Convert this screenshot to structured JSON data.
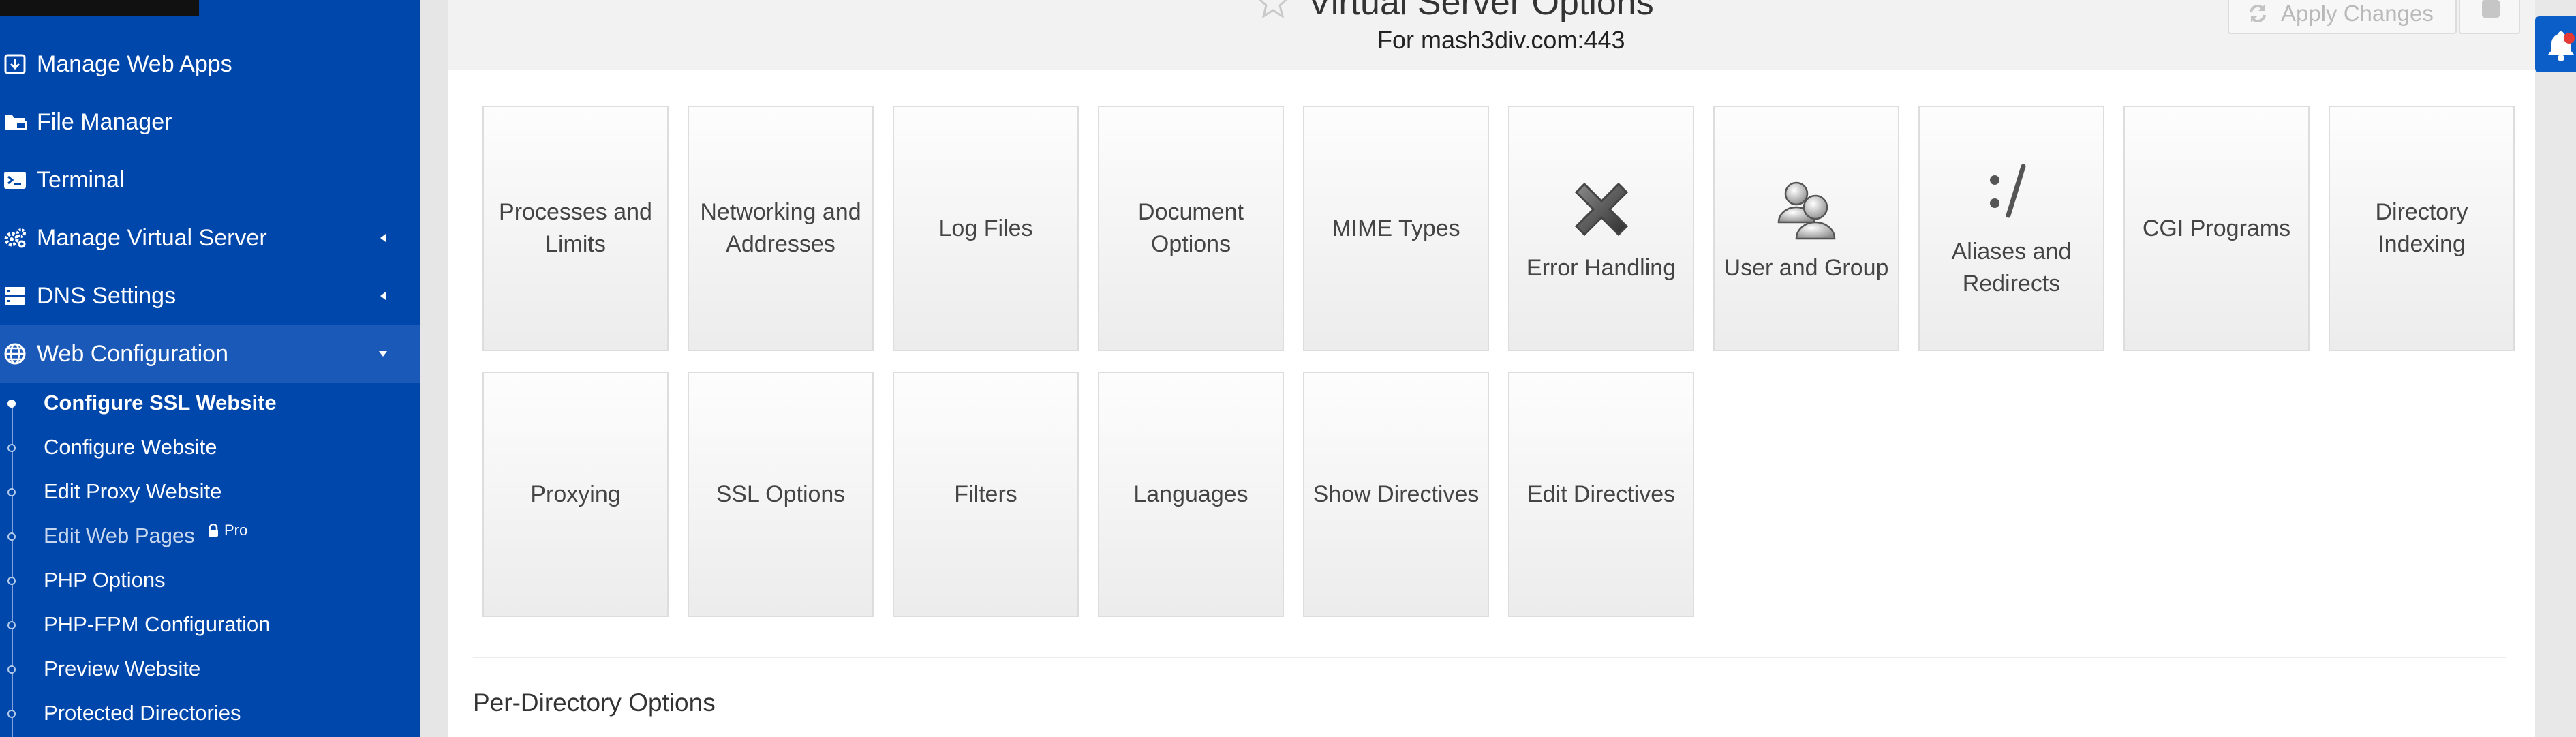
{
  "sidebar": {
    "menu": [
      {
        "label": "Manage Web Apps",
        "icon": "web-apps-icon"
      },
      {
        "label": "File Manager",
        "icon": "folder-icon"
      },
      {
        "label": "Terminal",
        "icon": "terminal-icon"
      },
      {
        "label": "Manage Virtual Server",
        "icon": "gears-icon"
      },
      {
        "label": "DNS Settings",
        "icon": "server-icon"
      },
      {
        "label": "Web Configuration",
        "icon": "globe-icon"
      }
    ],
    "submenu": [
      {
        "label": "Configure SSL Website"
      },
      {
        "label": "Configure Website"
      },
      {
        "label": "Edit Proxy Website"
      },
      {
        "label": "Edit Web Pages"
      },
      {
        "label": "PHP Options"
      },
      {
        "label": "PHP-FPM Configuration"
      },
      {
        "label": "Preview Website"
      },
      {
        "label": "Protected Directories"
      }
    ],
    "pro_badge": "Pro"
  },
  "header": {
    "title": "Virtual Server Options",
    "subtitle": "For mash3div.com:443",
    "apply_label": "Apply Changes"
  },
  "tiles": [
    {
      "label": "Processes and Limits",
      "icon": null
    },
    {
      "label": "Networking and Addresses",
      "icon": null
    },
    {
      "label": "Log Files",
      "icon": null
    },
    {
      "label": "Document Options",
      "icon": null
    },
    {
      "label": "MIME Types",
      "icon": null
    },
    {
      "label": "Error Handling",
      "icon": "error-x-icon"
    },
    {
      "label": "User and Group",
      "icon": "users-icon"
    },
    {
      "label": "Aliases and Redirects",
      "icon": "alias-slash-icon"
    },
    {
      "label": "CGI Programs",
      "icon": null
    },
    {
      "label": "Directory Indexing",
      "icon": null
    },
    {
      "label": "Proxying",
      "icon": null
    },
    {
      "label": "SSL Options",
      "icon": null
    },
    {
      "label": "Filters",
      "icon": null
    },
    {
      "label": "Languages",
      "icon": null
    },
    {
      "label": "Show Directives",
      "icon": null
    },
    {
      "label": "Edit Directives",
      "icon": null
    }
  ],
  "per_directory": {
    "heading": "Per-Directory Options"
  },
  "colors": {
    "sidebar_bg": "#0047ab",
    "sidebar_active": "#1b59b8",
    "notify_tab": "#0b5dc8"
  }
}
